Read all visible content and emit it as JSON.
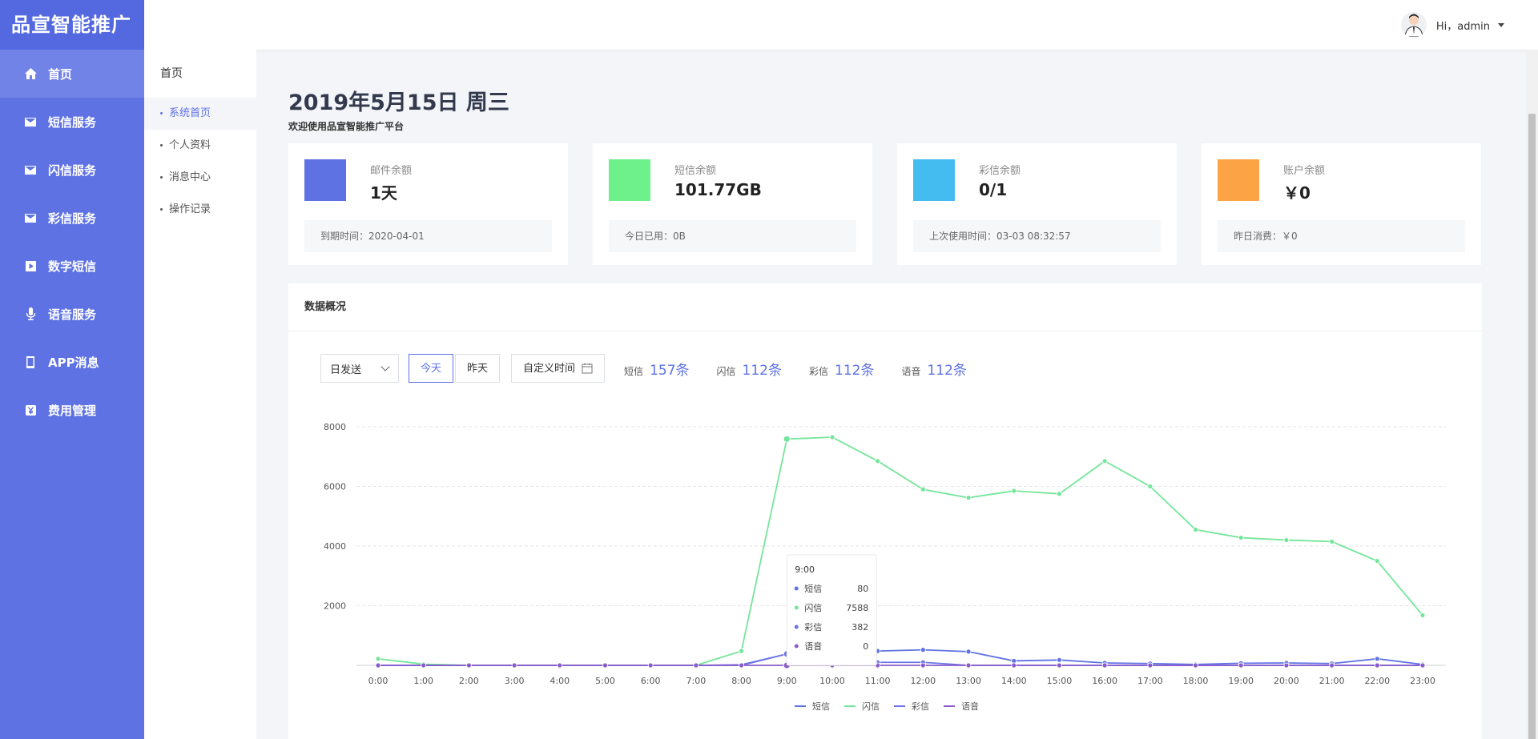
{
  "app": {
    "brand": "品宣智能推广"
  },
  "sidebar": {
    "items": [
      {
        "label": "首页",
        "icon": "home-icon"
      },
      {
        "label": "短信服务",
        "icon": "mail-icon"
      },
      {
        "label": "闪信服务",
        "icon": "mail-icon"
      },
      {
        "label": "彩信服务",
        "icon": "mail-icon"
      },
      {
        "label": "数字短信",
        "icon": "play-square-icon"
      },
      {
        "label": "语音服务",
        "icon": "microphone-icon"
      },
      {
        "label": "APP消息",
        "icon": "mobile-icon"
      },
      {
        "label": "费用管理",
        "icon": "yen-icon"
      }
    ]
  },
  "subnav": {
    "title": "首页",
    "items": [
      {
        "label": "系统首页"
      },
      {
        "label": "个人资料"
      },
      {
        "label": "消息中心"
      },
      {
        "label": "操作记录"
      }
    ]
  },
  "header": {
    "user_label": "Hi，admin"
  },
  "main": {
    "date": "2019年5月15日 周三",
    "welcome": "欢迎使用品宣智能推广平台"
  },
  "cards": [
    {
      "label": "邮件余额",
      "value": "1天",
      "foot": "到期时间：2020-04-01",
      "color": "#5f72e4"
    },
    {
      "label": "短信余额",
      "value": "101.77GB",
      "foot": "今日已用：0B",
      "color": "#6ef08a"
    },
    {
      "label": "彩信余额",
      "value": "0/1",
      "foot": "上次使用时间：03-03  08:32:57",
      "color": "#45bcf0"
    },
    {
      "label": "账户余额",
      "value": "￥0",
      "foot": "昨日消费：￥0",
      "color": "#fca445"
    }
  ],
  "overview": {
    "title": "数据概况",
    "select_value": "日发送",
    "btn_today": "今天",
    "btn_yesterday": "昨天",
    "btn_custom": "自定义时间",
    "stats": [
      {
        "label": "短信",
        "value": "157条"
      },
      {
        "label": "闪信",
        "value": "112条"
      },
      {
        "label": "彩信",
        "value": "112条"
      },
      {
        "label": "语音",
        "value": "112条"
      }
    ]
  },
  "chart_data": {
    "type": "line",
    "categories": [
      "0:00",
      "1:00",
      "2:00",
      "3:00",
      "4:00",
      "5:00",
      "6:00",
      "7:00",
      "8:00",
      "9:00",
      "10:00",
      "11:00",
      "12:00",
      "13:00",
      "14:00",
      "15:00",
      "16:00",
      "17:00",
      "18:00",
      "19:00",
      "20:00",
      "21:00",
      "22:00",
      "23:00"
    ],
    "ylim": [
      0,
      8000
    ],
    "yticks": [
      "2000",
      "4000",
      "6000",
      "8000"
    ],
    "series": [
      {
        "name": "短信",
        "color": "#5f72e4",
        "values": [
          0,
          0,
          0,
          0,
          0,
          0,
          0,
          0,
          20,
          380,
          760,
          480,
          520,
          460,
          150,
          180,
          80,
          60,
          30,
          70,
          80,
          60,
          220,
          30
        ]
      },
      {
        "name": "闪信",
        "color": "#74e69a",
        "values": [
          220,
          40,
          0,
          0,
          0,
          0,
          0,
          0,
          480,
          7588,
          7650,
          6850,
          5900,
          5620,
          5850,
          5750,
          6850,
          6000,
          4550,
          4280,
          4200,
          4150,
          3500,
          1680
        ]
      },
      {
        "name": "彩信",
        "color": "#6b74e8",
        "values": [
          0,
          0,
          0,
          0,
          0,
          0,
          0,
          0,
          0,
          382,
          100,
          100,
          100,
          0,
          0,
          0,
          0,
          0,
          0,
          0,
          0,
          0,
          0,
          0
        ]
      },
      {
        "name": "语音",
        "color": "#8a5cc9",
        "values": [
          0,
          0,
          0,
          0,
          0,
          0,
          0,
          0,
          0,
          0,
          0,
          0,
          0,
          0,
          0,
          0,
          0,
          0,
          0,
          0,
          0,
          0,
          0,
          0
        ]
      }
    ],
    "tooltip": {
      "x": "9:00",
      "rows": [
        {
          "name": "短信",
          "value": "80"
        },
        {
          "name": "闪信",
          "value": "7588"
        },
        {
          "name": "彩信",
          "value": "382"
        },
        {
          "name": "语音",
          "value": "0"
        }
      ]
    },
    "legend_position": "bottom-center"
  }
}
